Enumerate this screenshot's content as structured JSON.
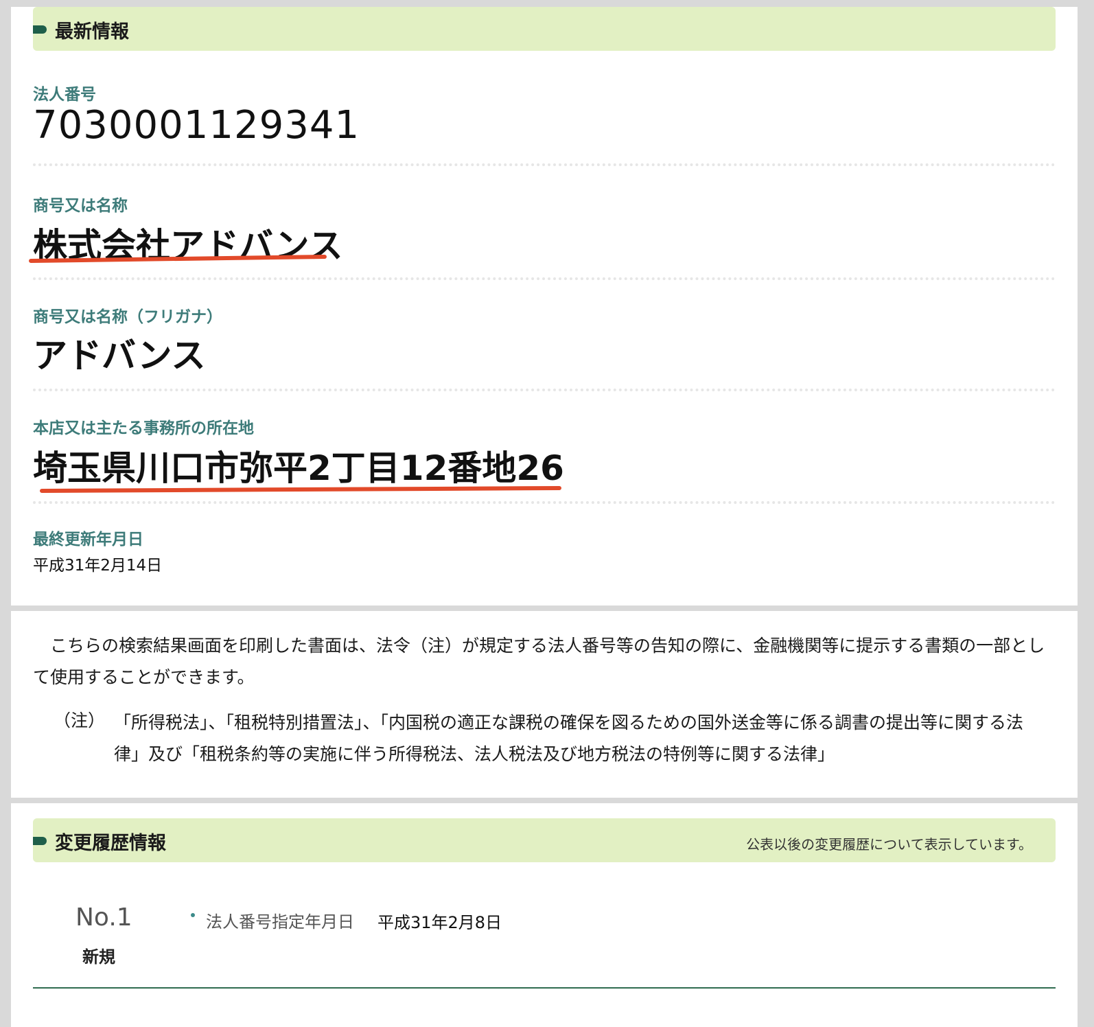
{
  "latest": {
    "header_title": "最新情報",
    "fields": [
      {
        "label": "法人番号",
        "value": "7030001129341"
      },
      {
        "label": "商号又は名称",
        "value": "株式会社アドバンス"
      },
      {
        "label": "商号又は名称（フリガナ）",
        "value": "アドバンス"
      },
      {
        "label": "本店又は主たる事務所の所在地",
        "value": "埼玉県川口市弥平2丁目12番地26"
      },
      {
        "label": "最終更新年月日",
        "value": "平成31年2月14日"
      }
    ]
  },
  "notice": {
    "paragraph": "　こちらの検索結果画面を印刷した書面は、法令（注）が規定する法人番号等の告知の際に、金融機関等に提示する書類の一部として使用することができます。",
    "note_tag": "（注）",
    "note_text": "「所得税法」、「租税特別措置法」、「内国税の適正な課税の確保を図るための国外送金等に係る調書の提出等に関する法律」及び「租税条約等の実施に伴う所得税法、法人税法及び地方税法の特例等に関する法律」"
  },
  "history": {
    "header_title": "変更履歴情報",
    "header_note": "公表以後の変更履歴について表示しています。",
    "entries": [
      {
        "no": "No.1",
        "type": "新規",
        "label": "法人番号指定年月日",
        "value": "平成31年2月8日"
      }
    ]
  },
  "colors": {
    "header_bg": "#e2f0c3",
    "label_teal": "#3d7b79",
    "underline_red": "#e24a2a",
    "marker_green": "#1f5f4a"
  }
}
